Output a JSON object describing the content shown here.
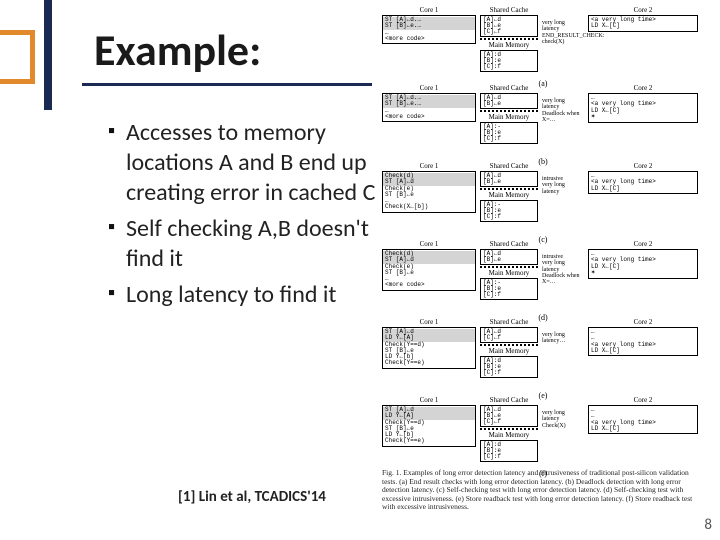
{
  "title": "Example:",
  "bullets": [
    "Accesses to memory locations A and B end up creating error in cached C",
    "Self checking A,B doesn't find it",
    "Long latency to find it"
  ],
  "citation": "[1] Lin et al, TCADICS'14",
  "slide_number": "8",
  "diagram": {
    "core_labels": {
      "left": "Core 1",
      "center": "Shared Cache",
      "right": "Core 2"
    },
    "main_memory": "Main Memory",
    "panels": [
      {
        "tag": "(a)",
        "core1": [
          "ST [A]←d.…",
          "ST [B]←e.…",
          "…",
          "<more code>"
        ],
        "cache": [
          "[A]←d",
          "[B]←e",
          "[C]←f"
        ],
        "mem": [
          "[A]:d",
          "[B]:e",
          "[C]:f"
        ],
        "core2": [
          "<a very long time>",
          "LD X←[C]"
        ],
        "annot": [
          "very long",
          "latency",
          "END_RESULT_CHECK:",
          "check(X)"
        ]
      },
      {
        "tag": "(b)",
        "core1": [
          "ST [A]←d.…",
          "ST [B]←e.…",
          "…",
          "<more code>"
        ],
        "cache": [
          "[A]←d",
          "[B]←e"
        ],
        "mem": [
          "[A]:-",
          "[B]:e",
          "[C]:f"
        ],
        "core2": [
          "…",
          "<a very long time>",
          "LD X←[C]"
        ],
        "annot": [
          "very long",
          "latency",
          "Deadlock when X=…"
        ],
        "star": true
      },
      {
        "tag": "(c)",
        "core1": [
          "Check(d)",
          "ST [A]←d",
          "Check(e)",
          "ST [B]←e",
          "…",
          "Check(X←[b])"
        ],
        "cache": [
          "[A]←d",
          "[B]←e",
          "",
          "[A]:-",
          "[B]:e",
          "[C]:f"
        ],
        "core2": [
          "…",
          "",
          "",
          "<a very long time>",
          "LD X←[C]"
        ],
        "annot": [
          "intrusive",
          "very long",
          "latency"
        ]
      },
      {
        "tag": "(d)",
        "core1": [
          "Check(d)",
          "ST [A]←d",
          "Check(e)",
          "ST [B]←e",
          "…",
          "<more code>"
        ],
        "cache": [
          "[A]←d",
          "[B]←e",
          "",
          "[A]:-",
          "[B]:e",
          "[C]:f"
        ],
        "core2": [
          "…",
          "",
          "",
          "<a very long time>",
          "LD X←[C]"
        ],
        "annot": [
          "intrusive",
          "very long",
          "latency",
          "Deadlock when X=…"
        ],
        "star": true
      },
      {
        "tag": "(e)",
        "core1": [
          "ST [A]←d",
          "LD Y←[A]",
          "Check(Y==d)",
          "ST [B]←e",
          "LD Y←[b]",
          "Check(Y==e)"
        ],
        "cache": [
          "[A]←d",
          "[C]←f",
          "",
          "[A]:d",
          "[B]:e",
          "[C]:f"
        ],
        "core2": [
          "…",
          "",
          "…",
          "<a very long time>",
          "LD X←[C]"
        ],
        "annot": [
          "very long",
          "latency…"
        ]
      },
      {
        "tag": "(f)",
        "core1": [
          "ST [A]←d",
          "LD Y←[A]",
          "Check(Y==d)",
          "ST [B]←e",
          "LD Y←[b]",
          "Check(Y==e)"
        ],
        "cache": [
          "[A]←d",
          "[B]←e",
          "[C]←f",
          "",
          "[A]:d",
          "[B]:e",
          "[C]:f"
        ],
        "core2": [
          "…",
          "",
          "…",
          "<a very long time>",
          "LD X←[C]"
        ],
        "annot": [
          "very long",
          "latency",
          "Check(X)"
        ]
      }
    ],
    "caption": "Fig. 1.   Examples of long error detection latency and intrusiveness of traditional post-silicon validation tests. (a) End result checks with long error detection latency. (b) Deadlock detection with long error detection latency. (c) Self-checking test with long error detection latency. (d) Self-checking test with excessive intrusiveness. (e) Store readback test with long error detection latency. (f) Store readback test with excessive intrusiveness."
  }
}
